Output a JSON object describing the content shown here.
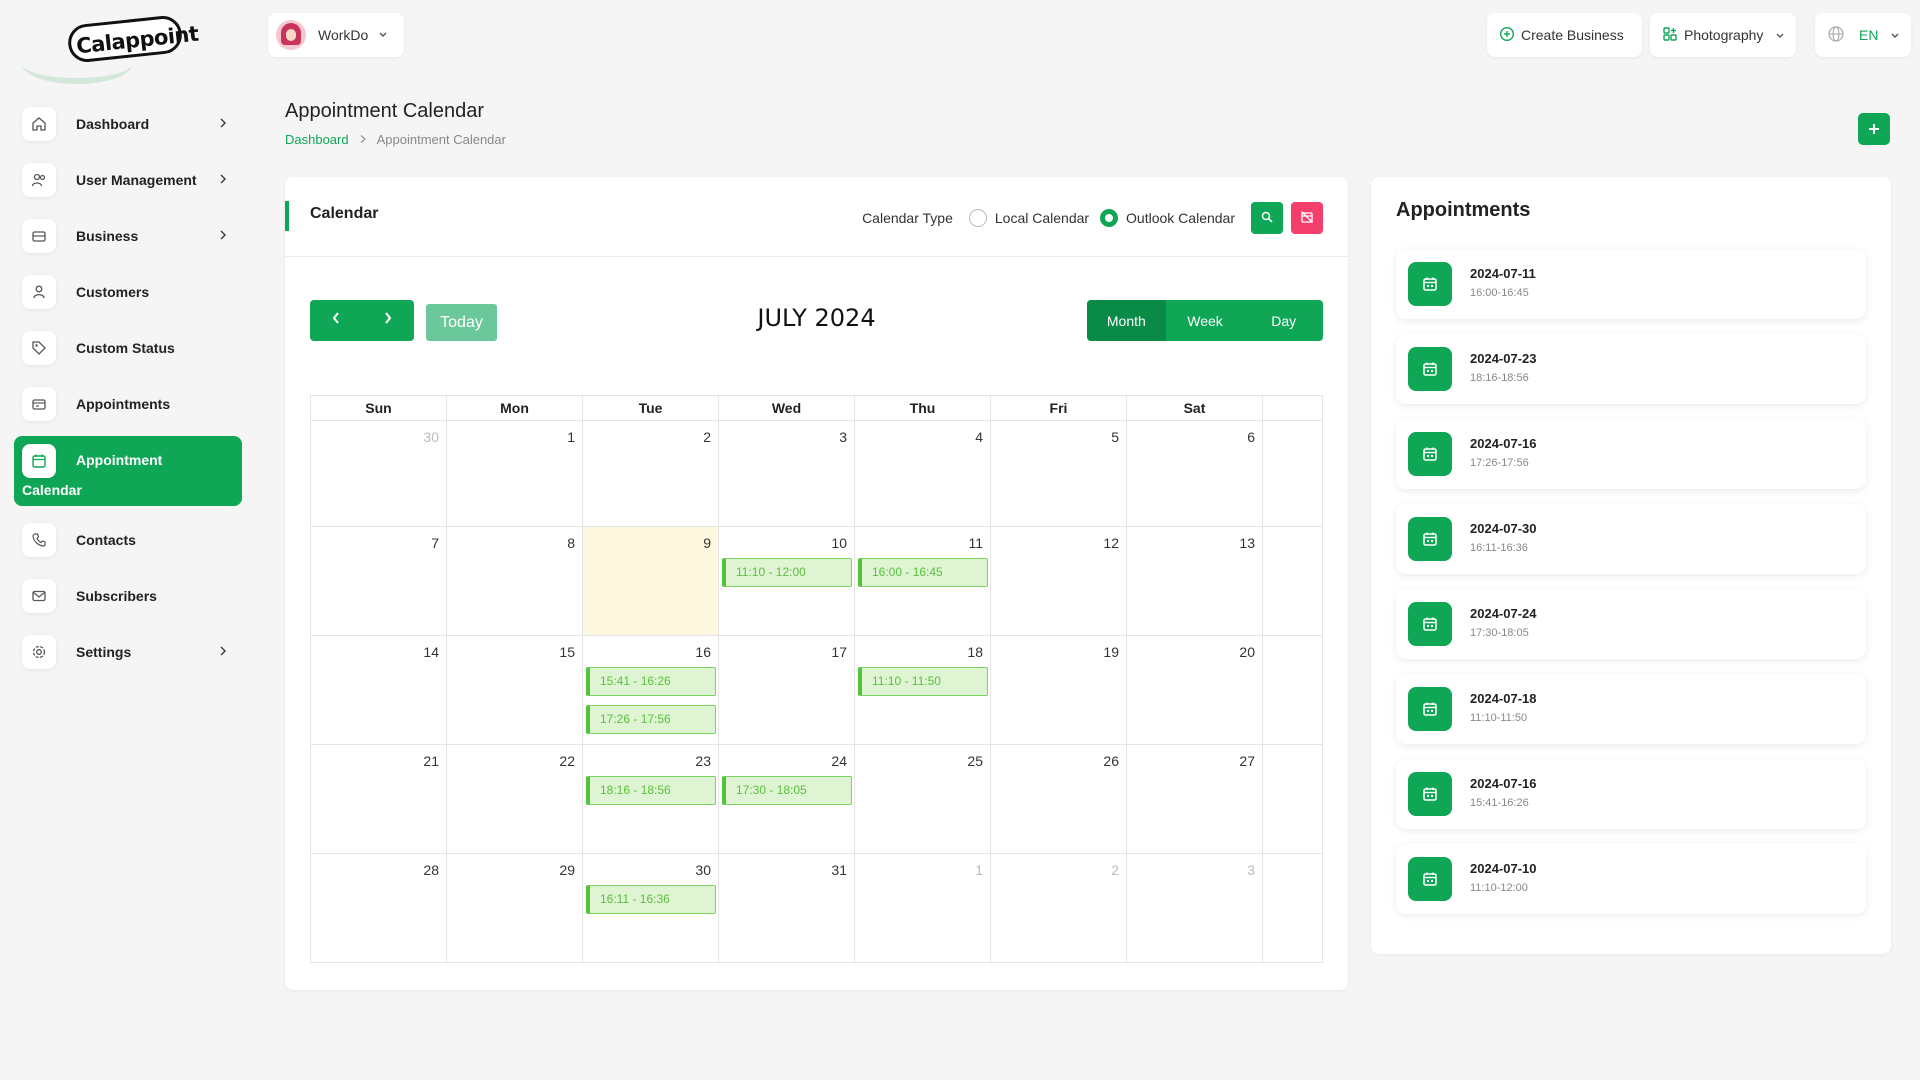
{
  "brand": {
    "logo_text": "Calappoint"
  },
  "sidebar": {
    "items": [
      {
        "label": "Dashboard",
        "icon": "home-icon",
        "has_chevron": true
      },
      {
        "label": "User Management",
        "icon": "users-icon",
        "has_chevron": true
      },
      {
        "label": "Business",
        "icon": "business-icon",
        "has_chevron": true
      },
      {
        "label": "Customers",
        "icon": "user-icon",
        "has_chevron": false
      },
      {
        "label": "Custom Status",
        "icon": "tag-icon",
        "has_chevron": false
      },
      {
        "label": "Appointments",
        "icon": "appointments-icon",
        "has_chevron": false
      },
      {
        "label": "Appointment",
        "label2": "Calendar",
        "icon": "calendar-icon",
        "active": true
      },
      {
        "label": "Contacts",
        "icon": "phone-icon",
        "has_chevron": false
      },
      {
        "label": "Subscribers",
        "icon": "mail-icon",
        "has_chevron": false
      },
      {
        "label": "Settings",
        "icon": "settings-icon",
        "has_chevron": true
      }
    ]
  },
  "topbar": {
    "user_name": "WorkDo",
    "create_business": "Create Business",
    "business_select": "Photography",
    "language": "EN"
  },
  "page": {
    "title": "Appointment Calendar",
    "breadcrumb": {
      "home": "Dashboard",
      "current": "Appointment Calendar"
    }
  },
  "calendar": {
    "card_title": "Calendar",
    "type_label": "Calendar Type",
    "options": {
      "local": "Local Calendar",
      "outlook": "Outlook Calendar"
    },
    "selected_option": "outlook",
    "today_label": "Today",
    "month_title": "JULY 2024",
    "views": {
      "month": "Month",
      "week": "Week",
      "day": "Day"
    },
    "active_view": "month",
    "weekdays": [
      "Sun",
      "Mon",
      "Tue",
      "Wed",
      "Thu",
      "Fri",
      "Sat"
    ],
    "weeks": [
      [
        {
          "d": "30",
          "other": true
        },
        {
          "d": "1"
        },
        {
          "d": "2"
        },
        {
          "d": "3"
        },
        {
          "d": "4"
        },
        {
          "d": "5"
        },
        {
          "d": "6"
        }
      ],
      [
        {
          "d": "7"
        },
        {
          "d": "8"
        },
        {
          "d": "9",
          "today": true
        },
        {
          "d": "10",
          "events": [
            "11:10 - 12:00"
          ]
        },
        {
          "d": "11",
          "events": [
            "16:00 - 16:45"
          ]
        },
        {
          "d": "12"
        },
        {
          "d": "13"
        }
      ],
      [
        {
          "d": "14"
        },
        {
          "d": "15"
        },
        {
          "d": "16",
          "events": [
            "15:41 - 16:26",
            "17:26 - 17:56"
          ]
        },
        {
          "d": "17"
        },
        {
          "d": "18",
          "events": [
            "11:10 - 11:50"
          ]
        },
        {
          "d": "19"
        },
        {
          "d": "20"
        }
      ],
      [
        {
          "d": "21"
        },
        {
          "d": "22"
        },
        {
          "d": "23",
          "events": [
            "18:16 - 18:56"
          ]
        },
        {
          "d": "24",
          "events": [
            "17:30 - 18:05"
          ]
        },
        {
          "d": "25"
        },
        {
          "d": "26"
        },
        {
          "d": "27"
        }
      ],
      [
        {
          "d": "28"
        },
        {
          "d": "29"
        },
        {
          "d": "30",
          "events": [
            "16:11 - 16:36"
          ]
        },
        {
          "d": "31"
        },
        {
          "d": "1",
          "other": true
        },
        {
          "d": "2",
          "other": true
        },
        {
          "d": "3",
          "other": true
        }
      ]
    ]
  },
  "appointments": {
    "title": "Appointments",
    "items": [
      {
        "date": "2024-07-11",
        "time": "16:00-16:45"
      },
      {
        "date": "2024-07-23",
        "time": "18:16-18:56"
      },
      {
        "date": "2024-07-16",
        "time": "17:26-17:56"
      },
      {
        "date": "2024-07-30",
        "time": "16:11-16:36"
      },
      {
        "date": "2024-07-24",
        "time": "17:30-18:05"
      },
      {
        "date": "2024-07-18",
        "time": "11:10-11:50"
      },
      {
        "date": "2024-07-16",
        "time": "15:41-16:26"
      },
      {
        "date": "2024-07-10",
        "time": "11:10-12:00"
      }
    ]
  },
  "colors": {
    "primary": "#0fa656",
    "danger": "#f43f6e",
    "event_bg": "#dff4d3",
    "event_border": "#4fc43a",
    "today_bg": "#fff8e1"
  }
}
